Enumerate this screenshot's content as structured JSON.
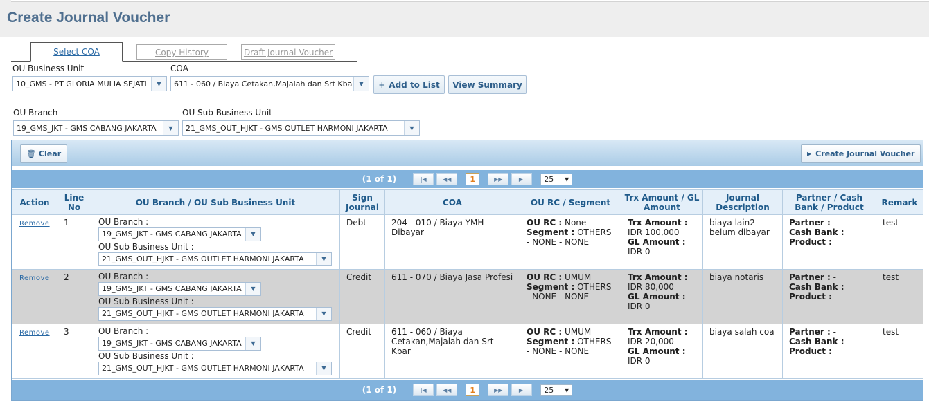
{
  "title": "Create Journal Voucher",
  "tabs": [
    {
      "label": "Select COA"
    },
    {
      "label": "Copy History"
    },
    {
      "label": "Draft Journal Voucher"
    }
  ],
  "form": {
    "ou_bu_label": "OU Business Unit",
    "ou_bu_value": "10_GMS - PT GLORIA MULIA SEJATI",
    "coa_label": "COA",
    "coa_value": "611 - 060 / Biaya Cetakan,Majalah dan Srt Kbar",
    "add_to_list": "Add to List",
    "view_summary": "View Summary",
    "ou_branch_label": "OU Branch",
    "ou_branch_value": "19_GMS_JKT - GMS CABANG JAKARTA",
    "ou_sub_label": "OU Sub Business Unit",
    "ou_sub_value": "21_GMS_OUT_HJKT - GMS OUTLET HARMONI JAKARTA"
  },
  "grid": {
    "clear": "Clear",
    "create": "Create Journal Voucher",
    "pager_info": "(1 of 1)",
    "page": "1",
    "page_size": "25",
    "headers": {
      "action": "Action",
      "line_no": "Line No",
      "branch": "OU Branch / OU Sub Business Unit",
      "sign": "Sign Journal",
      "coa": "COA",
      "rc": "OU RC / Segment",
      "trx": "Trx Amount / GL Amount",
      "desc": "Journal Description",
      "partner": "Partner / Cash Bank / Product",
      "remark": "Remark"
    },
    "labels": {
      "remove": "Remove",
      "ou_branch": "OU Branch :",
      "ou_sub": "OU Sub Business Unit :",
      "ou_rc": "OU RC :",
      "segment": "Segment :",
      "trx": "Trx Amount :",
      "gl": "GL Amount :",
      "partner": "Partner :",
      "cash_bank": "Cash Bank :",
      "product": "Product :"
    },
    "rows": [
      {
        "line": "1",
        "branch": "19_GMS_JKT - GMS CABANG JAKARTA",
        "sub": "21_GMS_OUT_HJKT - GMS OUTLET HARMONI JAKARTA",
        "sign": "Debt",
        "coa": "204 - 010 / Biaya YMH Dibayar",
        "rc": "None",
        "segment": "OTHERS - NONE - NONE",
        "trx": "IDR 100,000",
        "gl": "IDR 0",
        "desc": "biaya lain2 belum dibayar",
        "partner": "-",
        "remark": "test"
      },
      {
        "line": "2",
        "branch": "19_GMS_JKT - GMS CABANG JAKARTA",
        "sub": "21_GMS_OUT_HJKT - GMS OUTLET HARMONI JAKARTA",
        "sign": "Credit",
        "coa": "611 - 070 / Biaya Jasa Profesi",
        "rc": "UMUM",
        "segment": "OTHERS - NONE - NONE",
        "trx": "IDR 80,000",
        "gl": "IDR 0",
        "desc": "biaya notaris",
        "partner": "-",
        "remark": "test"
      },
      {
        "line": "3",
        "branch": "19_GMS_JKT - GMS CABANG JAKARTA",
        "sub": "21_GMS_OUT_HJKT - GMS OUTLET HARMONI JAKARTA",
        "sign": "Credit",
        "coa": "611 - 060 / Biaya Cetakan,Majalah dan Srt Kbar",
        "rc": "UMUM",
        "segment": "OTHERS - NONE - NONE",
        "trx": "IDR 20,000",
        "gl": "IDR 0",
        "desc": "biaya salah coa",
        "partner": "-",
        "remark": "test"
      }
    ]
  }
}
